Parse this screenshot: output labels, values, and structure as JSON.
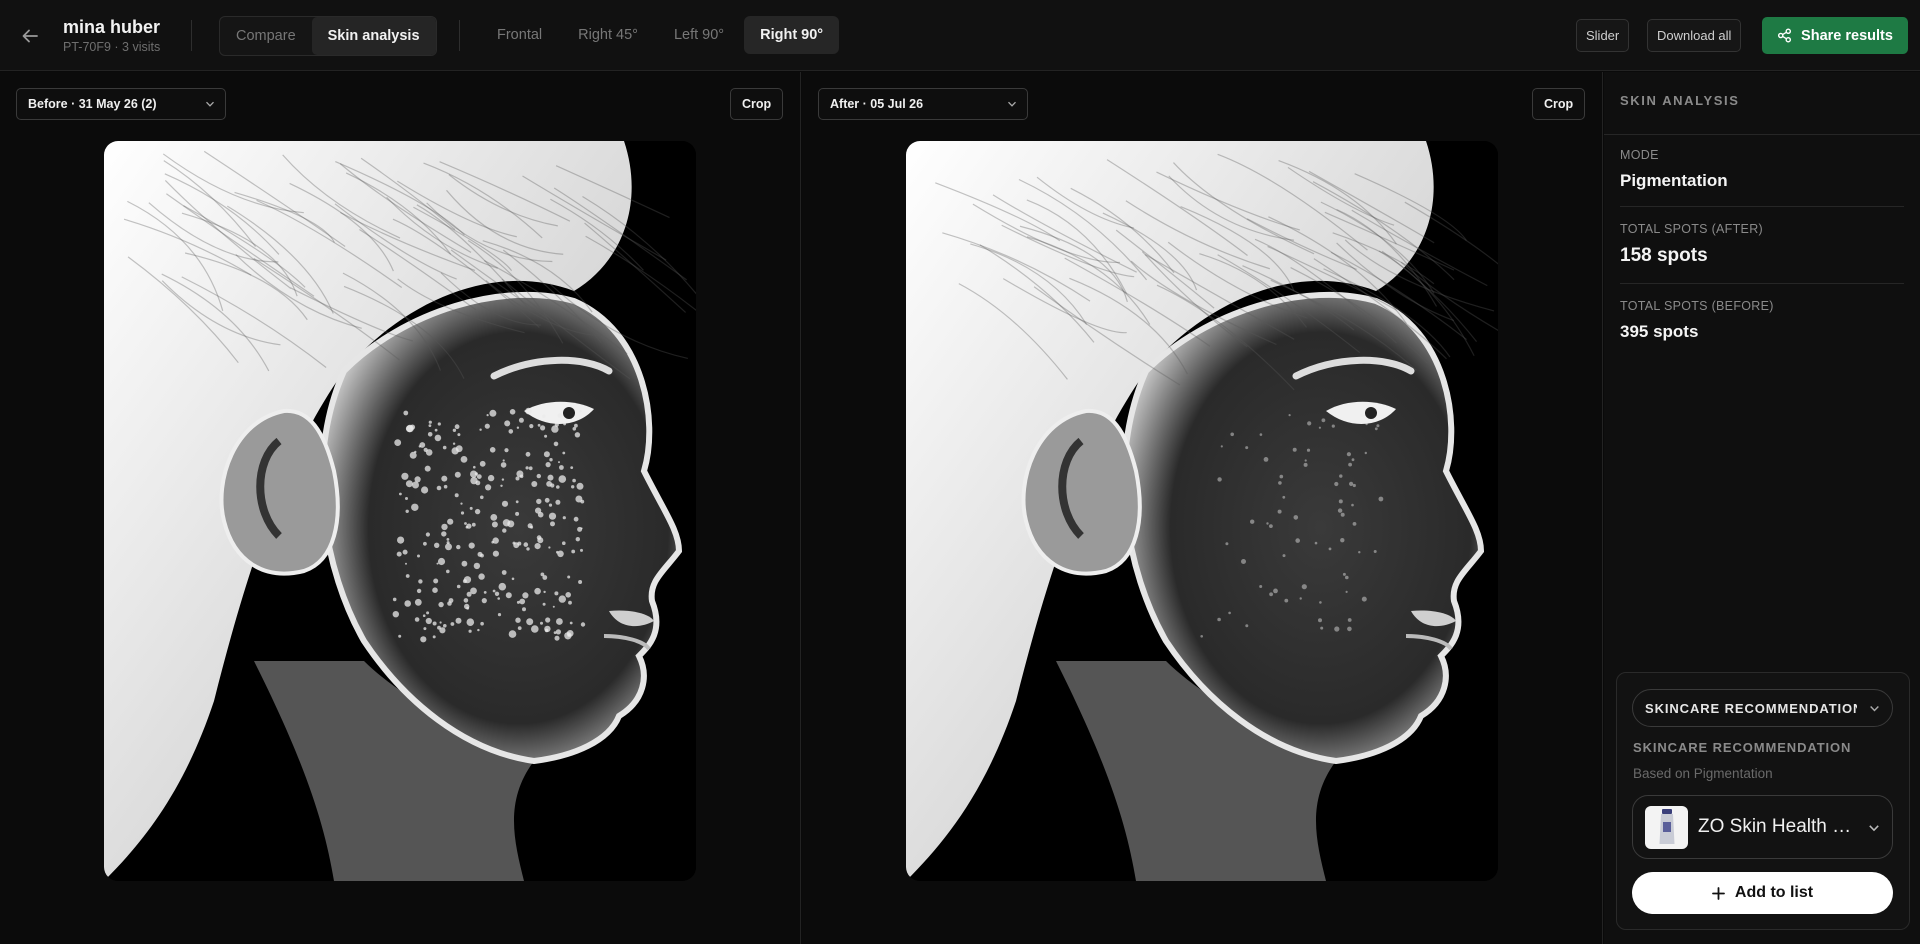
{
  "patient": {
    "name": "mina huber",
    "meta": "PT-70F9 · 3 visits"
  },
  "view_mode": {
    "compare": "Compare",
    "skin_analysis": "Skin analysis",
    "active": "Skin analysis"
  },
  "angles": [
    {
      "label": "Frontal",
      "active": false
    },
    {
      "label": "Right 45°",
      "active": false
    },
    {
      "label": "Left 90°",
      "active": false
    },
    {
      "label": "Right 90°",
      "active": true
    }
  ],
  "toolbar": {
    "slider": "Slider",
    "download_all": "Download all",
    "share": "Share results"
  },
  "before_panel": {
    "date_label": "Before · 31 May 26 (2)",
    "crop": "Crop"
  },
  "after_panel": {
    "date_label": "After · 05 Jul 26",
    "crop": "Crop"
  },
  "sidebar": {
    "title": "SKIN ANALYSIS",
    "mode_label": "MODE",
    "mode_value": "Pigmentation",
    "after_label": "TOTAL SPOTS (AFTER)",
    "after_value": "158 spots",
    "before_label": "TOTAL SPOTS (BEFORE)",
    "before_value": "395 spots"
  },
  "recommendation": {
    "select_label": "SKINCARE RECOMMENDATION",
    "heading": "SKINCARE RECOMMENDATION",
    "subtext": "Based on Pigmentation",
    "product_name": "ZO Skin Health Pigment Control Creme",
    "add_button": "Add to list"
  },
  "colors": {
    "accent_green": "#1e7a44",
    "background": "#0a0a0a",
    "panel": "#111111"
  },
  "icons": [
    "arrow-left-icon",
    "share-icon",
    "chevron-down-icon",
    "plus-icon",
    "product-tube-icon"
  ]
}
